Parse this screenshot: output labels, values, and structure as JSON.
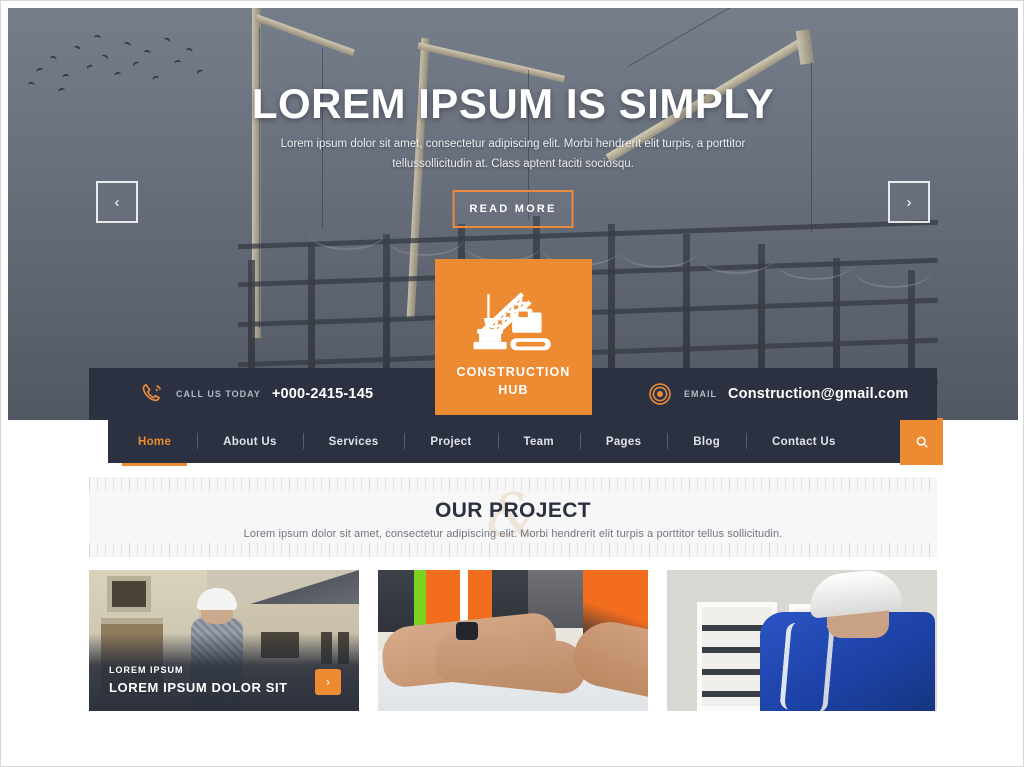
{
  "hero": {
    "title": "LOREM IPSUM IS SIMPLY",
    "subtitle": "Lorem ipsum dolor sit amet, consectetur adipiscing elit. Morbi hendrerit elit turpis, a porttitor tellussollicitudin at. Class aptent taciti sociosqu.",
    "cta_label": "READ MORE",
    "prev_icon": "chevron-left-icon",
    "next_icon": "chevron-right-icon",
    "prev_glyph": "‹",
    "next_glyph": "›"
  },
  "logo": {
    "icon": "crawler-crane-icon",
    "line1": "CONSTRUCTION",
    "line2": "HUB"
  },
  "contact": {
    "phone": {
      "icon": "phone-icon",
      "label": "CALL US TODAY",
      "value": "+000-2415-145"
    },
    "email": {
      "icon": "at-sign-icon",
      "label": "EMAIL",
      "value": "Construction@gmail.com"
    }
  },
  "nav": {
    "items": [
      {
        "label": "Home",
        "active": true
      },
      {
        "label": "About Us",
        "active": false
      },
      {
        "label": "Services",
        "active": false
      },
      {
        "label": "Project",
        "active": false
      },
      {
        "label": "Team",
        "active": false
      },
      {
        "label": "Pages",
        "active": false
      },
      {
        "label": "Blog",
        "active": false
      },
      {
        "label": "Contact Us",
        "active": false
      }
    ],
    "search_icon": "search-icon"
  },
  "section": {
    "title": "OUR PROJECT",
    "subtitle": "Lorem ipsum dolor sit amet, consectetur adipiscing elit. Morbi hendrerit elit turpis a porttitor tellus sollicitudin.",
    "watermark": "&"
  },
  "projects": [
    {
      "image": "man-in-hardhat-at-house-construction",
      "eyebrow": "LOREM IPSUM",
      "title": "LOREM IPSUM DOLOR SIT",
      "arrow_icon": "chevron-right-icon",
      "arrow_glyph": "›",
      "has_caption": true
    },
    {
      "image": "two-workers-reviewing-blueprint",
      "eyebrow": "",
      "title": "",
      "arrow_icon": "",
      "arrow_glyph": "",
      "has_caption": false
    },
    {
      "image": "electrician-in-blue-overalls-at-panel",
      "eyebrow": "",
      "title": "",
      "arrow_icon": "",
      "arrow_glyph": "",
      "has_caption": false
    }
  ],
  "colors": {
    "accent": "#ed8b33",
    "dark": "#2b3140",
    "hero_sky": "#6b7380",
    "section_bg": "#f7f7f7"
  }
}
